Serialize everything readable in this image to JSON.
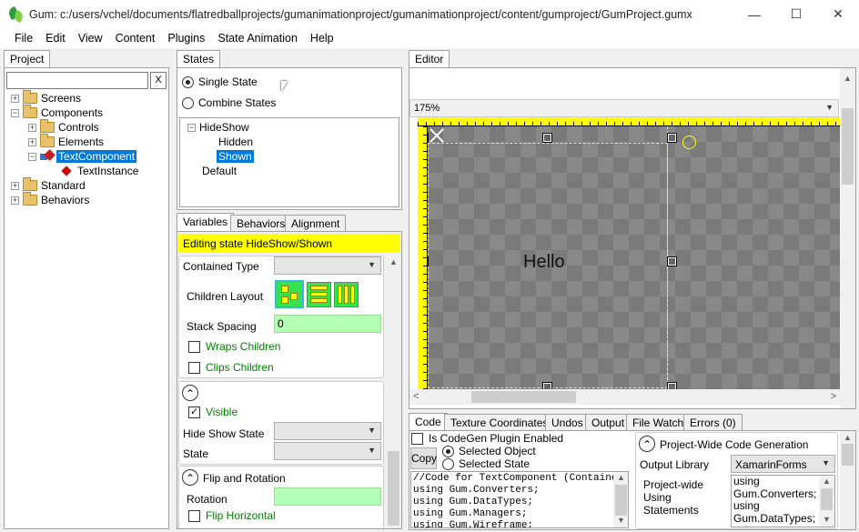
{
  "window": {
    "title": "Gum: c:/users/vchel/documents/flatredballprojects/gumanimationproject/gumanimationproject/content/gumproject/GumProject.gumx",
    "minimize": "—",
    "maximize": "☐",
    "close": "✕"
  },
  "menu": [
    "File",
    "Edit",
    "View",
    "Content",
    "Plugins",
    "State Animation",
    "Help"
  ],
  "project": {
    "tab": "Project",
    "search_value": "",
    "clear_label": "X",
    "tree": {
      "screens": "Screens",
      "components": "Components",
      "controls": "Controls",
      "elements": "Elements",
      "text_component": "TextComponent",
      "text_instance": "TextInstance",
      "standard": "Standard",
      "behaviors": "Behaviors"
    }
  },
  "states": {
    "tab": "States",
    "single_state": "Single State",
    "combine_states": "Combine States",
    "tree": {
      "hide_show": "HideShow",
      "hidden": "Hidden",
      "shown": "Shown",
      "default": "Default"
    }
  },
  "variables": {
    "tabs": [
      "Variables",
      "Behaviors",
      "Alignment"
    ],
    "editing_banner": "Editing state HideShow/Shown",
    "contained_type_label": "Contained Type",
    "children_layout_label": "Children Layout",
    "stack_spacing_label": "Stack Spacing",
    "stack_spacing_value": "0",
    "wraps_children": "Wraps Children",
    "clips_children": "Clips Children",
    "visible": "Visible",
    "hide_show_state_label": "Hide Show State",
    "state_label": "State",
    "flip_rotation_header": "Flip and Rotation",
    "rotation_label": "Rotation",
    "flip_horizontal": "Flip Horizontal",
    "collapse_glyph": "⌃"
  },
  "editor": {
    "tab": "Editor",
    "zoom": "175%",
    "canvas_text": "Hello"
  },
  "code": {
    "tabs": [
      "Code",
      "Texture Coordinates",
      "Undos",
      "Output",
      "File Watch",
      "Errors (0)"
    ],
    "codegen_enabled_label": "Is CodeGen Plugin Enabled",
    "copy_label": "Copy",
    "selected_object": "Selected Object",
    "selected_state": "Selected State",
    "code_lines": [
      "//Code for TextComponent (Container)",
      "using Gum.Converters;",
      "using Gum.DataTypes;",
      "using Gum.Managers;",
      "using Gum.Wireframe;"
    ],
    "project_wide_header": "Project-Wide Code Generation",
    "output_library_label": "Output Library",
    "output_library_value": "XamarinForms",
    "project_wide_using_label": "Project-wide Using Statements",
    "using_lines": [
      "using",
      "Gum.Converters;",
      "using",
      "Gum.DataTypes;",
      "using"
    ]
  },
  "colors": {
    "selection": "#0078d7",
    "banner": "#ffff00",
    "green_field": "#b3ffb3",
    "ruler": "#ffff00"
  }
}
